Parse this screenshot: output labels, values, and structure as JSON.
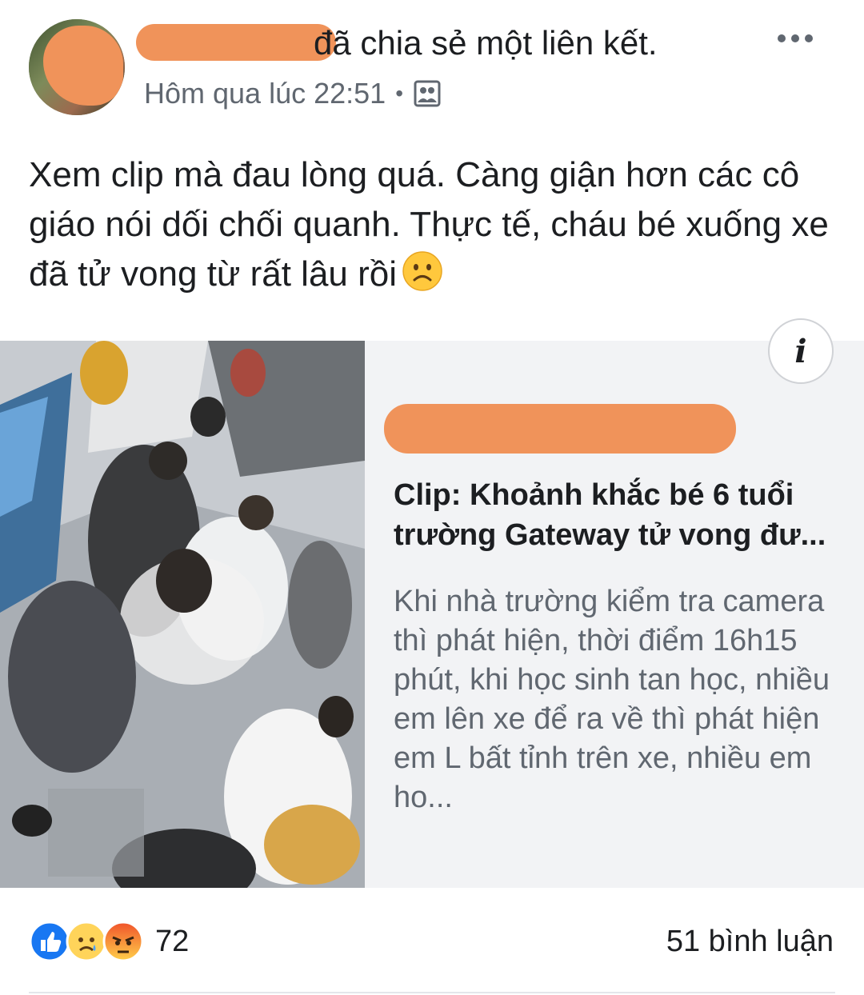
{
  "post": {
    "action_text": "đã chia sẻ một liên kết.",
    "timestamp": "Hôm qua lúc 22:51",
    "separator": "•",
    "audience_icon": "friends-group-icon",
    "text": "Xem clip mà đau lòng quá. Càng giận hơn các cô giáo nói dối chối quanh. Thực tế, cháu bé xuống xe đã tử vong từ rất lâu rồi",
    "emoji": "frowning-face-emoji"
  },
  "link": {
    "title": "Clip: Khoảnh khắc bé 6 tuổi trường Gateway tử vong đư...",
    "description": "Khi nhà trường kiểm tra camera thì phát hiện, thời điểm 16h15 phút, khi học sinh tan học, nhiều em lên xe để ra về thì phát hiện em L bất tỉnh trên xe, nhiều em ho...",
    "info_icon": "i"
  },
  "footer": {
    "reaction_icons": [
      "like-icon",
      "sad-icon",
      "angry-icon"
    ],
    "reaction_count": "72",
    "comments": "51 bình luận"
  },
  "colors": {
    "redaction": "#f0935a",
    "like_blue": "#1877f2",
    "secondary_text": "#606770"
  }
}
